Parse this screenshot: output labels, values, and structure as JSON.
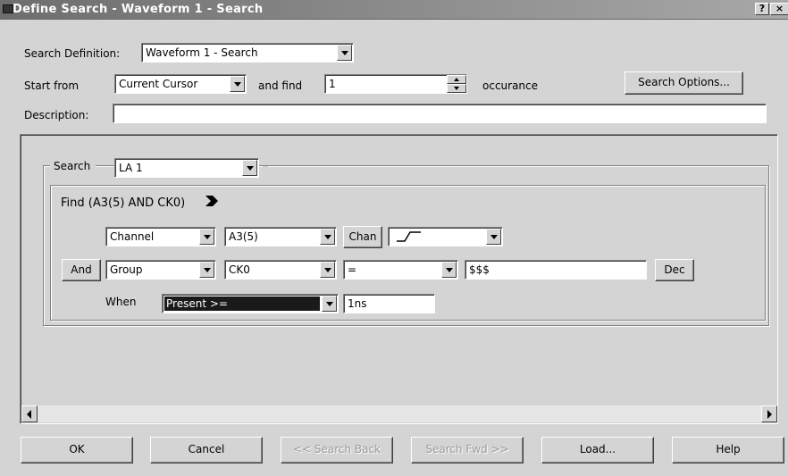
{
  "window": {
    "title": "Define Search - Waveform 1 - Search",
    "help_glyph": "?",
    "close_glyph": "×"
  },
  "top": {
    "search_definition_label": "Search Definition:",
    "search_definition_value": "Waveform 1 - Search",
    "start_from_label": "Start from",
    "start_from_value": "Current Cursor",
    "and_find_label": "and find",
    "occurrence_count": "1",
    "occurance_label": "occurance",
    "search_options_label": "Search Options...",
    "description_label": "Description:",
    "description_value": ""
  },
  "search_group": {
    "label": "Search",
    "source_value": "LA 1",
    "find_expression": "Find (A3(5) AND CK0)",
    "row1": {
      "type_value": "Channel",
      "signal_value": "A3(5)",
      "chan_button": "Chan"
    },
    "row2": {
      "and_button": "And",
      "type_value": "Group",
      "signal_value": "CK0",
      "operator_value": "=",
      "pattern_value": "$$$",
      "radix_button": "Dec"
    },
    "when": {
      "label": "When",
      "condition_value": "Present >=",
      "time_value": "1ns"
    }
  },
  "buttons": {
    "ok": "OK",
    "cancel": "Cancel",
    "search_back": "<< Search Back",
    "search_fwd": "Search Fwd >>",
    "load": "Load...",
    "help": "Help"
  }
}
